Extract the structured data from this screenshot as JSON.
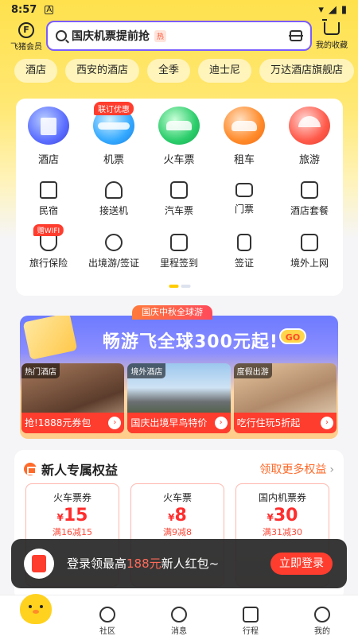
{
  "status_bar": {
    "time": "8:57",
    "notif": "A"
  },
  "header": {
    "member_label": "飞猪会员",
    "member_icon": "F",
    "search_text": "国庆机票提前抢",
    "hot_badge": "热",
    "favorites_label": "我的收藏"
  },
  "chips": [
    "酒店",
    "西安的酒店",
    "全季",
    "迪士尼",
    "万达酒店旗舰店"
  ],
  "main_services": [
    {
      "label": "酒店",
      "icon": "hotel-icon"
    },
    {
      "label": "机票",
      "icon": "airplane-icon",
      "promo": "联订优惠"
    },
    {
      "label": "火车票",
      "icon": "train-icon"
    },
    {
      "label": "租车",
      "icon": "car-icon"
    },
    {
      "label": "旅游",
      "icon": "beach-icon"
    }
  ],
  "grid_row1": [
    {
      "label": "民宿",
      "icon": "house-icon"
    },
    {
      "label": "接送机",
      "icon": "shuttle-plane-icon"
    },
    {
      "label": "汽车票",
      "icon": "bus-icon"
    },
    {
      "label": "门票",
      "icon": "ticket-icon"
    },
    {
      "label": "酒店套餐",
      "icon": "hotel-package-icon"
    }
  ],
  "grid_row2": [
    {
      "label": "旅行保险",
      "icon": "insurance-icon",
      "tag": "赠WIFI"
    },
    {
      "label": "出境游/签证",
      "icon": "globe-icon"
    },
    {
      "label": "里程签到",
      "icon": "checkin-icon"
    },
    {
      "label": "签证",
      "icon": "visa-icon"
    },
    {
      "label": "境外上网",
      "icon": "wifi-icon"
    }
  ],
  "banner": {
    "tag": "国庆中秋全球游",
    "title": "畅游飞全球300元起!",
    "go": "GO",
    "tiles": [
      {
        "tag": "热门酒店",
        "bar": "抢!1888元券包"
      },
      {
        "tag": "境外酒店",
        "bar": "国庆出境早鸟特价"
      },
      {
        "tag": "度假出游",
        "bar": "吃行住玩5折起"
      }
    ]
  },
  "newcomer": {
    "title": "新人专属权益",
    "more": "领取更多权益",
    "coupons": [
      {
        "name": "火车票券",
        "currency": "¥",
        "amount": "15",
        "rule": "满16减15"
      },
      {
        "name": "火车票",
        "currency": "¥",
        "amount": "8",
        "rule": "满9减8"
      },
      {
        "name": "国内机票券",
        "currency": "¥",
        "amount": "30",
        "rule": "满31减30"
      }
    ]
  },
  "toast": {
    "text_before": "登录领最高",
    "amount": "188元",
    "text_after": "新人红包~",
    "button": "立即登录"
  },
  "tabbar": [
    {
      "label": "",
      "icon": "home-chick-icon"
    },
    {
      "label": "社区",
      "icon": "planet-icon"
    },
    {
      "label": "消息",
      "icon": "message-icon"
    },
    {
      "label": "行程",
      "icon": "calendar-icon"
    },
    {
      "label": "我的",
      "icon": "profile-icon"
    }
  ],
  "colors": {
    "brand_yellow": "#ffe14d",
    "accent_red": "#ff3d2e",
    "search_border": "#7a5cff",
    "orange": "#ff6a2a"
  }
}
